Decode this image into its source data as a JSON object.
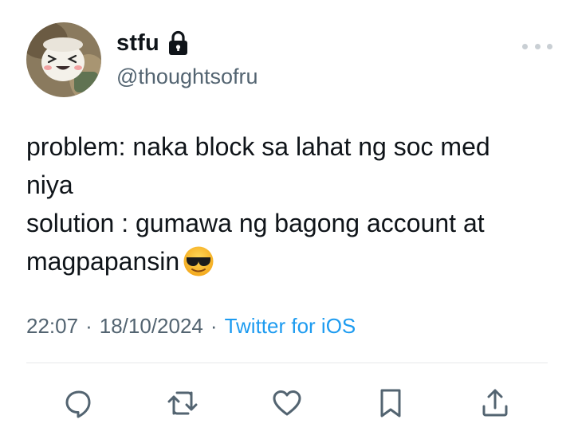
{
  "user": {
    "display_name": "stfu",
    "handle": "@thoughtsofru",
    "protected_icon": "lock-icon",
    "avatar_icon": "laughing-plush-avatar"
  },
  "tweet": {
    "lines": [
      "problem: naka block sa lahat ng soc med",
      "niya",
      "solution : gumawa ng bagong account at",
      "magpapansin"
    ],
    "emoji": "smiling-face-with-sunglasses"
  },
  "meta": {
    "time": "22:07",
    "separator": "·",
    "date": "18/10/2024",
    "source": "Twitter for iOS"
  },
  "actions": [
    "reply-icon",
    "retweet-icon",
    "like-icon",
    "bookmark-icon",
    "share-icon"
  ],
  "colors": {
    "text": "#0f1419",
    "secondary": "#536471",
    "link": "#1d9bf0",
    "divider": "#e7e9ea"
  }
}
